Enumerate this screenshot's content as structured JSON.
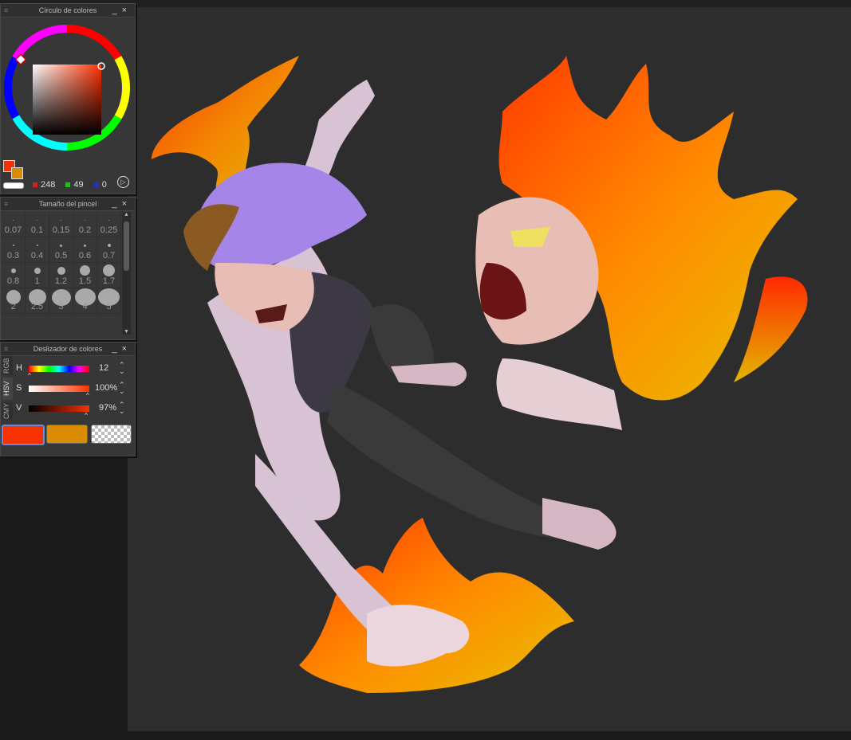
{
  "color_wheel_panel": {
    "title": "Círculo de colores",
    "minimize_glyph": "_",
    "close_glyph": "×",
    "main_color": "#f83100",
    "sub_color": "#d98c00",
    "rgb": {
      "r": "248",
      "g": "49",
      "b": "0"
    },
    "rgb_colors": {
      "r": "#d02020",
      "g": "#20c020",
      "b": "#2030d0"
    }
  },
  "brush_size_panel": {
    "title": "Tamaño del pincel",
    "minimize_glyph": "_",
    "close_glyph": "×",
    "sizes": [
      "0.07",
      "0.1",
      "0.15",
      "0.2",
      "0.25",
      "0.3",
      "0.4",
      "0.5",
      "0.6",
      "0.7",
      "0.8",
      "1",
      "1.2",
      "1.5",
      "1.7",
      "2",
      "2.5",
      "3",
      "4",
      "5"
    ]
  },
  "color_slider_panel": {
    "title": "Deslizador de colores",
    "minimize_glyph": "_",
    "close_glyph": "×",
    "tabs": [
      "RGB",
      "HSV",
      "CMY"
    ],
    "h": {
      "label": "H",
      "value": "12"
    },
    "s": {
      "label": "S",
      "value": "100%"
    },
    "v": {
      "label": "V",
      "value": "97%"
    },
    "chips": {
      "main": "#f83100",
      "sub": "#d98c00"
    }
  },
  "canvas": {
    "background": "#2d2d2d"
  }
}
